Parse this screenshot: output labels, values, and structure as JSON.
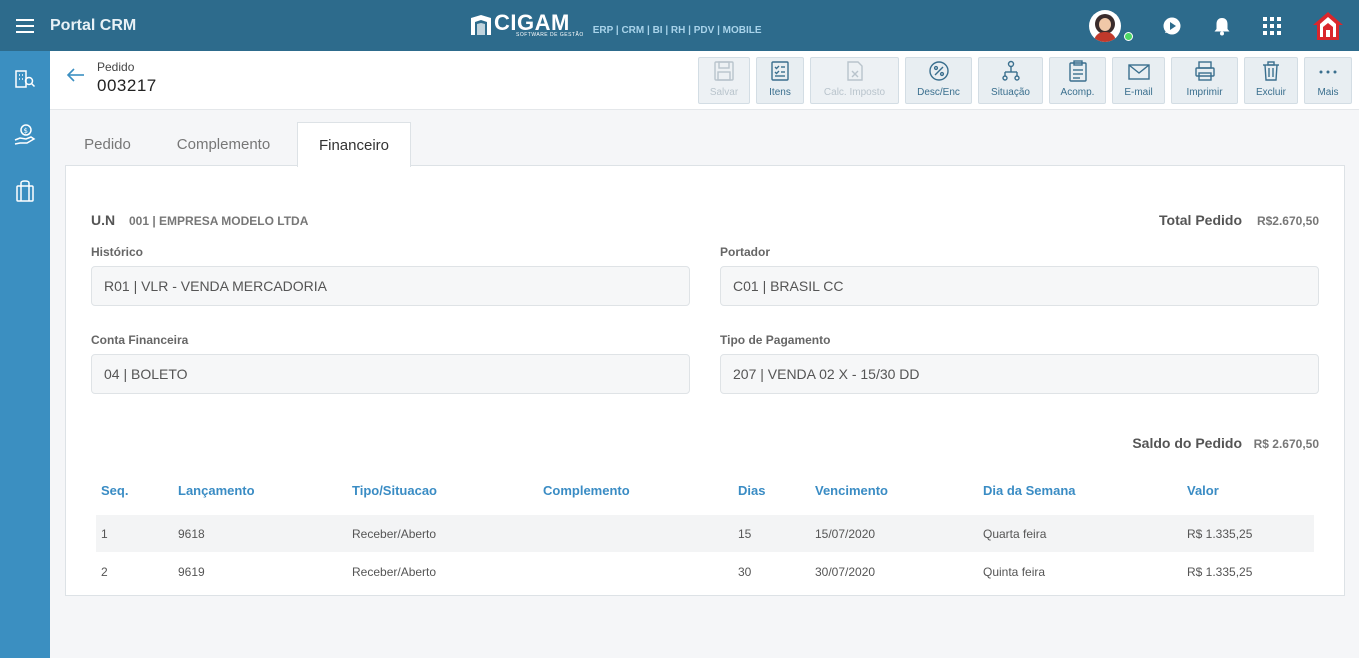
{
  "topbar": {
    "app_title": "Portal CRM",
    "brand_name": "CIGAM",
    "brand_sub": "SOFTWARE DE GESTÃO",
    "brand_modules": "ERP | CRM | BI | RH | PDV | MOBILE"
  },
  "header": {
    "label": "Pedido",
    "number": "003217"
  },
  "toolbar": {
    "save": "Salvar",
    "items": "Itens",
    "calc_tax": "Calc. Imposto",
    "disc": "Desc/Enc",
    "situation": "Situação",
    "follow": "Acomp.",
    "email": "E-mail",
    "print": "Imprimir",
    "delete": "Excluir",
    "more": "Mais"
  },
  "tabs": [
    "Pedido",
    "Complemento",
    "Financeiro"
  ],
  "panel": {
    "un_label": "U.N",
    "un_value": "001 | EMPRESA MODELO LTDA",
    "total_label": "Total Pedido",
    "total_value": "R$2.670,50",
    "historico_label": "Histórico",
    "historico_value": "R01 | VLR - VENDA MERCADORIA",
    "portador_label": "Portador",
    "portador_value": "C01 | BRASIL CC",
    "conta_label": "Conta Financeira",
    "conta_value": "04 | BOLETO",
    "tipo_label": "Tipo de Pagamento",
    "tipo_value": "207 | VENDA 02 X - 15/30 DD",
    "saldo_label": "Saldo do Pedido",
    "saldo_value": "R$ 2.670,50"
  },
  "table": {
    "headers": [
      "Seq.",
      "Lançamento",
      "Tipo/Situacao",
      "Complemento",
      "Dias",
      "Vencimento",
      "Dia da Semana",
      "Valor"
    ],
    "rows": [
      [
        "1",
        "9618",
        "Receber/Aberto",
        "",
        "15",
        "15/07/2020",
        "Quarta feira",
        "R$ 1.335,25"
      ],
      [
        "2",
        "9619",
        "Receber/Aberto",
        "",
        "30",
        "30/07/2020",
        "Quinta feira",
        "R$ 1.335,25"
      ]
    ]
  }
}
